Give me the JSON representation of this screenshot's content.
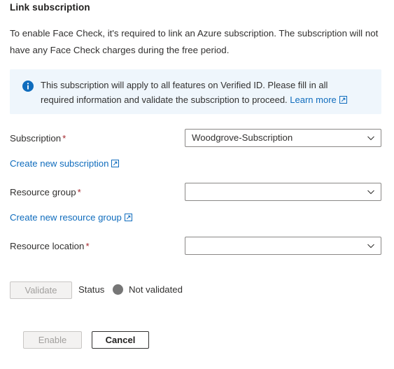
{
  "page": {
    "title": "Link subscription",
    "intro": "To enable Face Check, it's required to link an Azure subscription. The subscription will not have any Face Check charges during the free period."
  },
  "info_banner": {
    "icon": "info-circle-icon",
    "text_before_link": "This subscription will apply to all features on Verified ID. Please fill in all required information and validate the subscription to proceed. ",
    "link_label": "Learn more",
    "link_icon": "external-link-icon",
    "background_color": "#eff6fc",
    "icon_color": "#0f6cbd"
  },
  "form": {
    "required_marker": "*",
    "required_marker_color": "#a4262c",
    "fields": [
      {
        "label": "Subscription",
        "required": true,
        "value": "Woodgrove-Subscription",
        "placeholder": "",
        "chevron_icon": "chevron-down-icon"
      },
      {
        "label": "Resource group",
        "required": true,
        "value": "",
        "placeholder": "",
        "chevron_icon": "chevron-down-icon"
      },
      {
        "label": "Resource location",
        "required": true,
        "value": "",
        "placeholder": "",
        "chevron_icon": "chevron-down-icon"
      }
    ],
    "links": [
      {
        "label": "Create new subscription",
        "icon": "external-link-icon"
      },
      {
        "label": "Create new resource group",
        "icon": "external-link-icon"
      }
    ]
  },
  "validation": {
    "validate_button": "Validate",
    "validate_enabled": false,
    "status_label": "Status",
    "status_value": "Not validated",
    "status_dot_color": "#767676"
  },
  "actions": {
    "enable_label": "Enable",
    "enable_enabled": false,
    "cancel_label": "Cancel",
    "cancel_enabled": true
  },
  "colors": {
    "link": "#0f6cbd",
    "text": "#323130",
    "border": "#8a8886",
    "disabled_text": "#a19f9d",
    "disabled_bg": "#f3f2f1"
  }
}
